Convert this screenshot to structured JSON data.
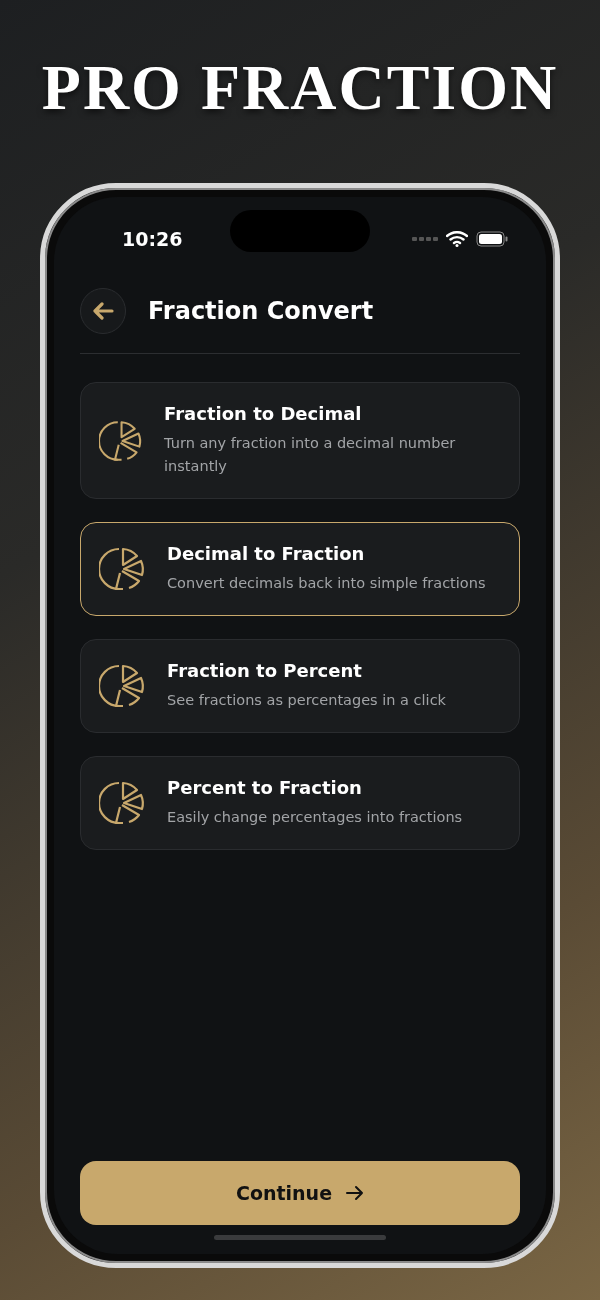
{
  "headline": "PRO FRACTION",
  "status_bar": {
    "time": "10:26"
  },
  "header": {
    "title": "Fraction Convert"
  },
  "options": [
    {
      "title": "Fraction to Decimal",
      "description": "Turn any fraction into a decimal number instantly",
      "selected": false
    },
    {
      "title": "Decimal to Fraction",
      "description": "Convert decimals back into simple fractions",
      "selected": true
    },
    {
      "title": "Fraction to Percent",
      "description": "See fractions as percentages in a click",
      "selected": false
    },
    {
      "title": "Percent to Fraction",
      "description": "Easily change percentages into fractions",
      "selected": false
    }
  ],
  "continue_button": {
    "label": "Continue"
  }
}
